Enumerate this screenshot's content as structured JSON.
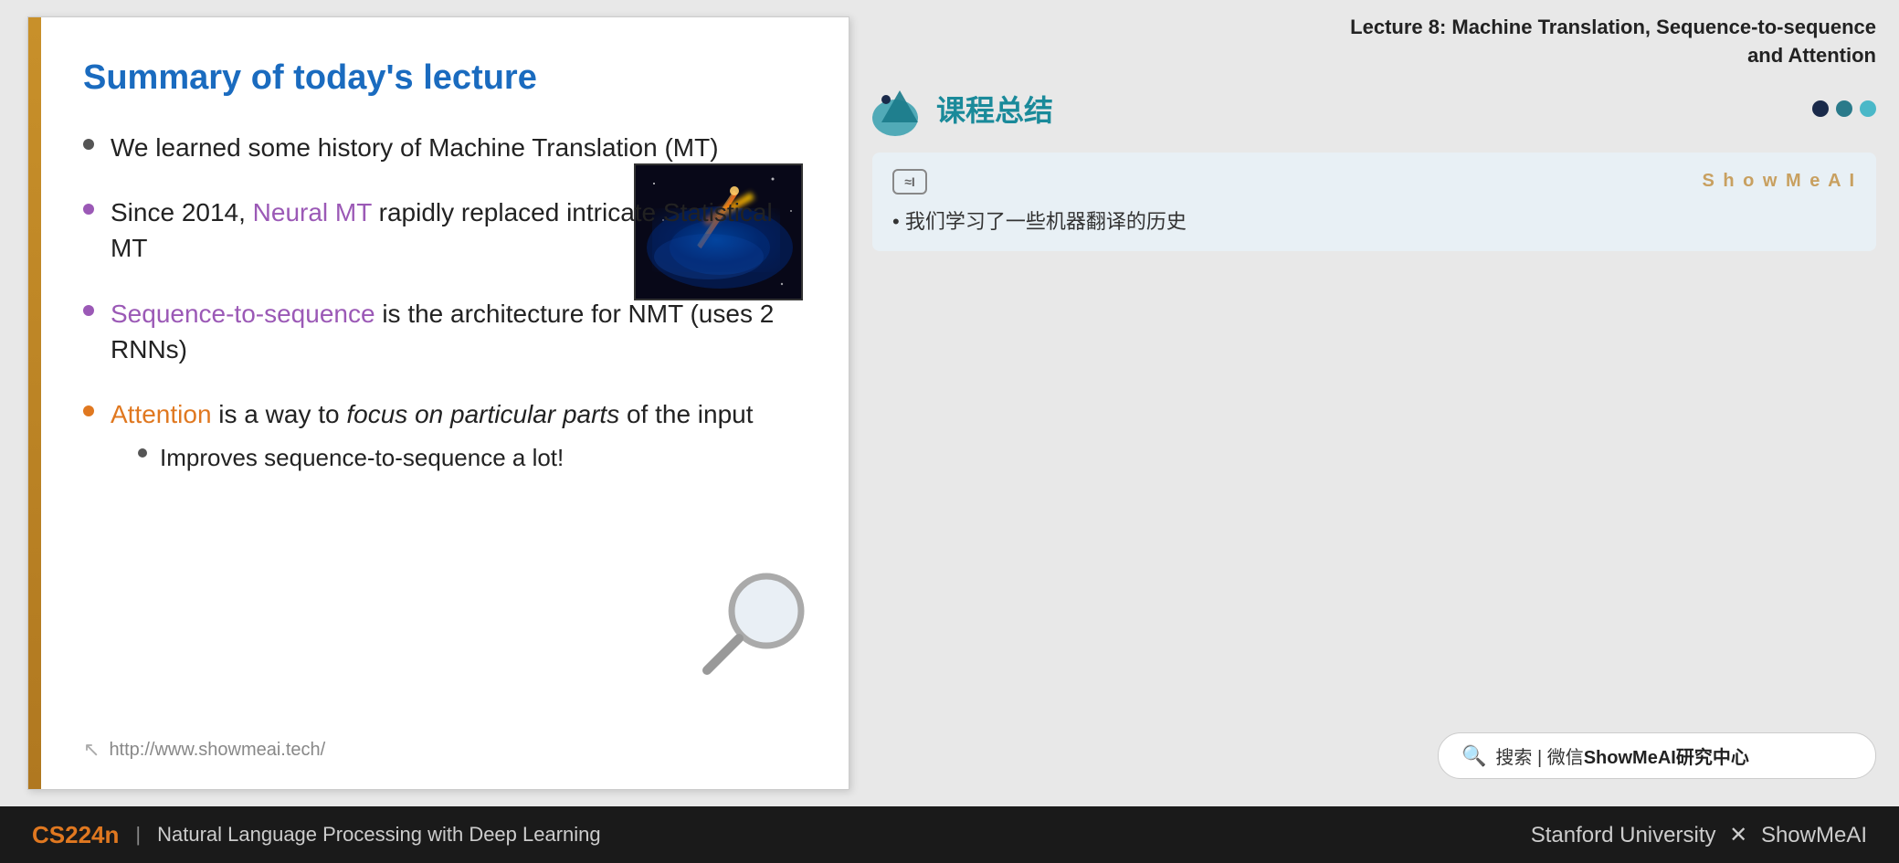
{
  "slide": {
    "title": "Summary of today's lecture",
    "left_bar_color": "#c8902a",
    "bullets": [
      {
        "id": "bullet1",
        "text": "We learned some history of Machine Translation (MT)",
        "dot_color": "#555",
        "has_image": true
      },
      {
        "id": "bullet2",
        "text_prefix": "Since 2014, ",
        "highlight": "Neural MT",
        "text_suffix": " rapidly replaced intricate Statistical MT",
        "highlight_color": "#9b59b6"
      },
      {
        "id": "bullet3",
        "text_prefix": "",
        "highlight": "Sequence-to-sequence",
        "text_suffix": " is the architecture for NMT (uses 2 RNNs)",
        "highlight_color": "#9b59b6"
      },
      {
        "id": "bullet4",
        "highlight": "Attention",
        "text_prefix": "",
        "text_suffix": " is a way to focus on particular parts of the input",
        "highlight_color": "#e07820",
        "sub_bullet": "Improves sequence-to-sequence a lot!"
      }
    ],
    "footer_link": "http://www.showmeai.tech/"
  },
  "right_panel": {
    "lecture_header_line1": "Lecture 8:  Machine Translation, Sequence-to-sequence",
    "lecture_header_line2": "and Attention",
    "lesson_title": "课程总结",
    "showmeai_card": {
      "badge_text": "≈I",
      "brand_text": "S h o w M e A I",
      "bullet_text": "•  我们学习了一些机器翻译的历史"
    },
    "search_bar": {
      "icon": "🔍",
      "text": "搜索 | 微信",
      "bold_text": "ShowMeAI研究中心"
    }
  },
  "bottom_bar": {
    "course_code": "CS224n",
    "separator": "|",
    "course_name": "Natural Language Processing with Deep Learning",
    "right_text_prefix": "Stanford University",
    "x_mark": "✕",
    "right_text_suffix": "ShowMeAI"
  }
}
